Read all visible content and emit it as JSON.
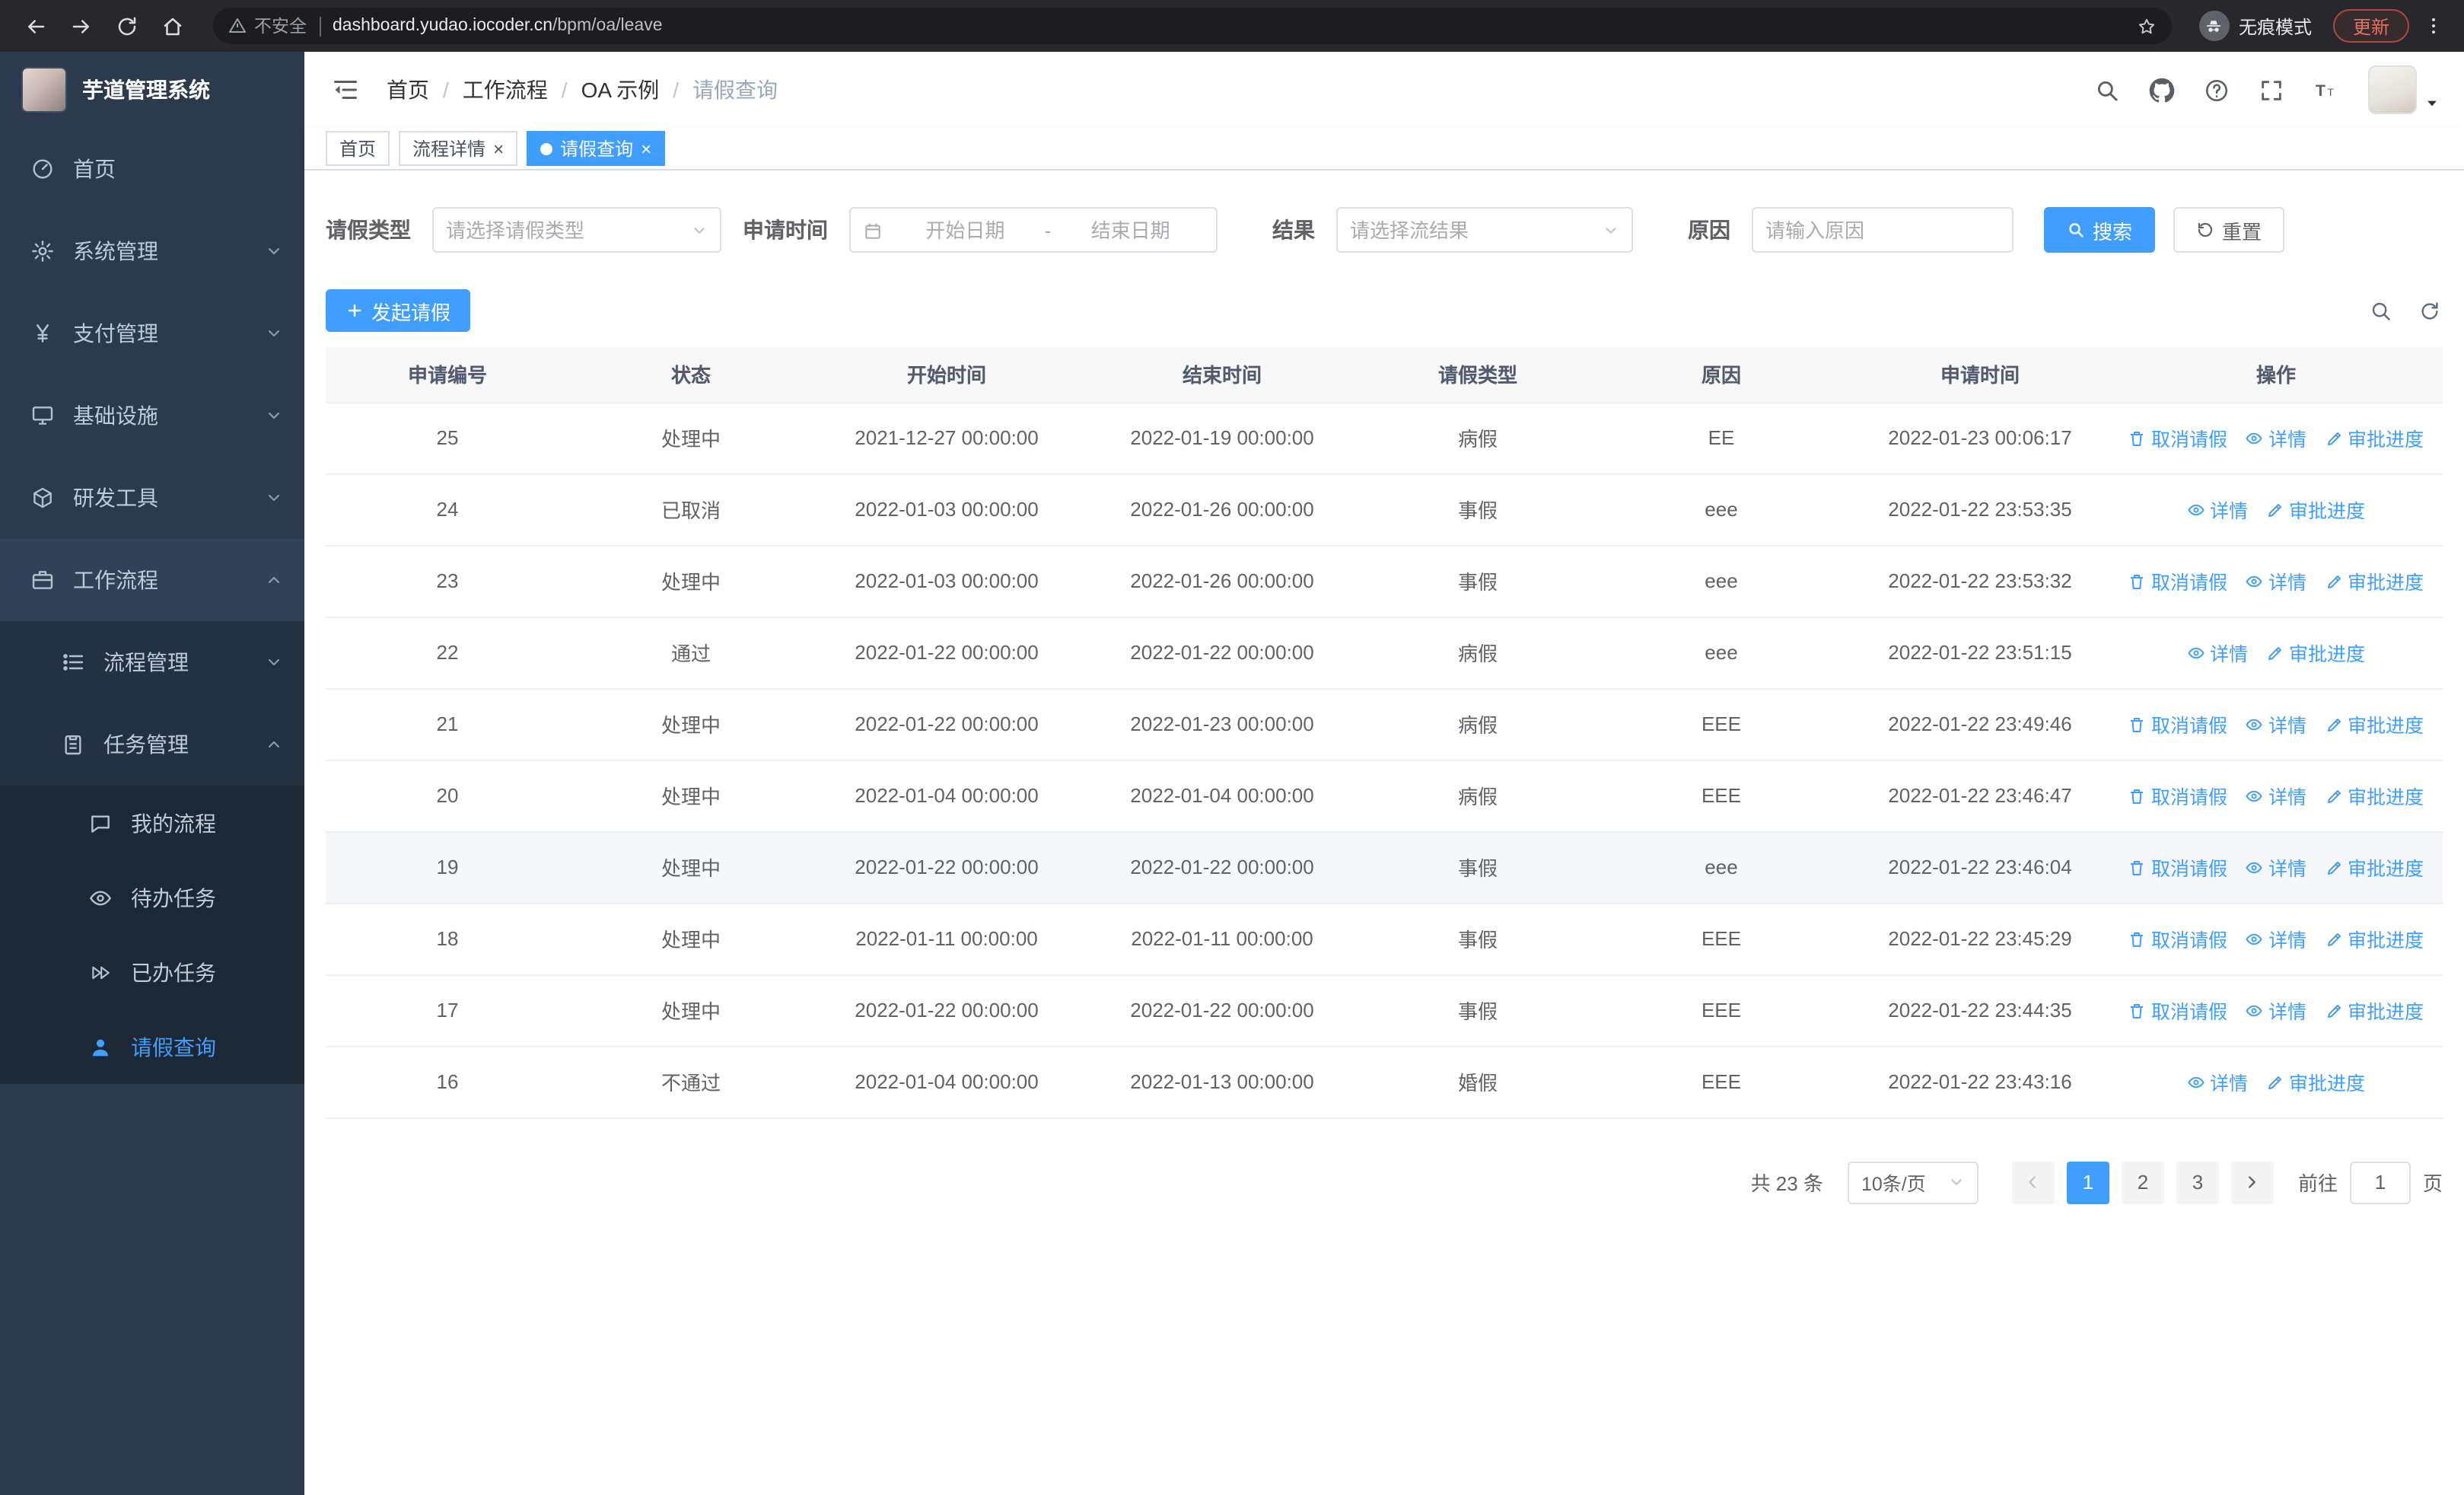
{
  "colors": {
    "primary": "#409eff",
    "sidebar_bg": "#2b3a4d",
    "sidebar_submenu_bg": "#233140",
    "sidebar_deep_bg": "#1c2836",
    "chrome_bg": "#28282c",
    "update_accent": "#e8705f",
    "table_border": "#ebeef5"
  },
  "browser": {
    "security_label": "不安全",
    "url_domain": "dashboard.yudao.iocoder.cn",
    "url_path": "/bpm/oa/leave",
    "incognito_label": "无痕模式",
    "update_label": "更新"
  },
  "sidebar": {
    "title": "芋道管理系统",
    "items": [
      {
        "label": "首页",
        "icon": "dashboard-icon"
      },
      {
        "label": "系统管理",
        "icon": "gear-icon"
      },
      {
        "label": "支付管理",
        "icon": "payment-icon"
      },
      {
        "label": "基础设施",
        "icon": "infrastructure-icon"
      },
      {
        "label": "研发工具",
        "icon": "devtools-icon"
      },
      {
        "label": "工作流程",
        "icon": "workflow-icon"
      }
    ],
    "process_group": {
      "label": "流程管理",
      "icon": "process-list-icon"
    },
    "task_group": {
      "label": "任务管理",
      "icon": "task-clipboard-icon"
    },
    "task_items": [
      {
        "label": "我的流程",
        "icon": "message-icon"
      },
      {
        "label": "待办任务",
        "icon": "eye-icon"
      },
      {
        "label": "已办任务",
        "icon": "done-icon"
      },
      {
        "label": "请假查询",
        "icon": "user-icon",
        "active": true
      }
    ]
  },
  "header": {
    "breadcrumb": [
      "首页",
      "工作流程",
      "OA 示例",
      "请假查询"
    ]
  },
  "tabs": [
    {
      "label": "首页",
      "active": false,
      "closable": false
    },
    {
      "label": "流程详情",
      "active": false,
      "closable": true
    },
    {
      "label": "请假查询",
      "active": true,
      "closable": true
    }
  ],
  "filters": {
    "leave_type_label": "请假类型",
    "leave_type_placeholder": "请选择请假类型",
    "apply_time_label": "申请时间",
    "start_date_placeholder": "开始日期",
    "range_separator": "-",
    "end_date_placeholder": "结束日期",
    "result_label": "结果",
    "result_placeholder": "请选择流结果",
    "reason_label": "原因",
    "reason_placeholder": "请输入原因",
    "search_button": "搜索",
    "reset_button": "重置"
  },
  "toolbar": {
    "create_button": "发起请假"
  },
  "table": {
    "columns": [
      "申请编号",
      "状态",
      "开始时间",
      "结束时间",
      "请假类型",
      "原因",
      "申请时间",
      "操作"
    ],
    "action_labels": {
      "cancel": "取消请假",
      "detail": "详情",
      "progress": "审批进度"
    },
    "action_icons": {
      "cancel": "trash-icon",
      "detail": "eye-icon",
      "progress": "edit-icon"
    },
    "rows": [
      {
        "id": "25",
        "status": "处理中",
        "start": "2021-12-27 00:00:00",
        "end": "2022-01-19 00:00:00",
        "type": "病假",
        "reason": "EE",
        "applied": "2022-01-23 00:06:17",
        "actions": [
          "cancel",
          "detail",
          "progress"
        ]
      },
      {
        "id": "24",
        "status": "已取消",
        "start": "2022-01-03 00:00:00",
        "end": "2022-01-26 00:00:00",
        "type": "事假",
        "reason": "eee",
        "applied": "2022-01-22 23:53:35",
        "actions": [
          "detail",
          "progress"
        ]
      },
      {
        "id": "23",
        "status": "处理中",
        "start": "2022-01-03 00:00:00",
        "end": "2022-01-26 00:00:00",
        "type": "事假",
        "reason": "eee",
        "applied": "2022-01-22 23:53:32",
        "actions": [
          "cancel",
          "detail",
          "progress"
        ]
      },
      {
        "id": "22",
        "status": "通过",
        "start": "2022-01-22 00:00:00",
        "end": "2022-01-22 00:00:00",
        "type": "病假",
        "reason": "eee",
        "applied": "2022-01-22 23:51:15",
        "actions": [
          "detail",
          "progress"
        ]
      },
      {
        "id": "21",
        "status": "处理中",
        "start": "2022-01-22 00:00:00",
        "end": "2022-01-23 00:00:00",
        "type": "病假",
        "reason": "EEE",
        "applied": "2022-01-22 23:49:46",
        "actions": [
          "cancel",
          "detail",
          "progress"
        ]
      },
      {
        "id": "20",
        "status": "处理中",
        "start": "2022-01-04 00:00:00",
        "end": "2022-01-04 00:00:00",
        "type": "病假",
        "reason": "EEE",
        "applied": "2022-01-22 23:46:47",
        "actions": [
          "cancel",
          "detail",
          "progress"
        ]
      },
      {
        "id": "19",
        "status": "处理中",
        "start": "2022-01-22 00:00:00",
        "end": "2022-01-22 00:00:00",
        "type": "事假",
        "reason": "eee",
        "applied": "2022-01-22 23:46:04",
        "actions": [
          "cancel",
          "detail",
          "progress"
        ],
        "highlighted": true
      },
      {
        "id": "18",
        "status": "处理中",
        "start": "2022-01-11 00:00:00",
        "end": "2022-01-11 00:00:00",
        "type": "事假",
        "reason": "EEE",
        "applied": "2022-01-22 23:45:29",
        "actions": [
          "cancel",
          "detail",
          "progress"
        ]
      },
      {
        "id": "17",
        "status": "处理中",
        "start": "2022-01-22 00:00:00",
        "end": "2022-01-22 00:00:00",
        "type": "事假",
        "reason": "EEE",
        "applied": "2022-01-22 23:44:35",
        "actions": [
          "cancel",
          "detail",
          "progress"
        ]
      },
      {
        "id": "16",
        "status": "不通过",
        "start": "2022-01-04 00:00:00",
        "end": "2022-01-13 00:00:00",
        "type": "婚假",
        "reason": "EEE",
        "applied": "2022-01-22 23:43:16",
        "actions": [
          "detail",
          "progress"
        ]
      }
    ]
  },
  "pagination": {
    "total_label": "共 23 条",
    "page_size_label": "10条/页",
    "pages": [
      "1",
      "2",
      "3"
    ],
    "active_page": "1",
    "goto_prefix": "前往",
    "goto_value": "1",
    "goto_suffix": "页"
  }
}
